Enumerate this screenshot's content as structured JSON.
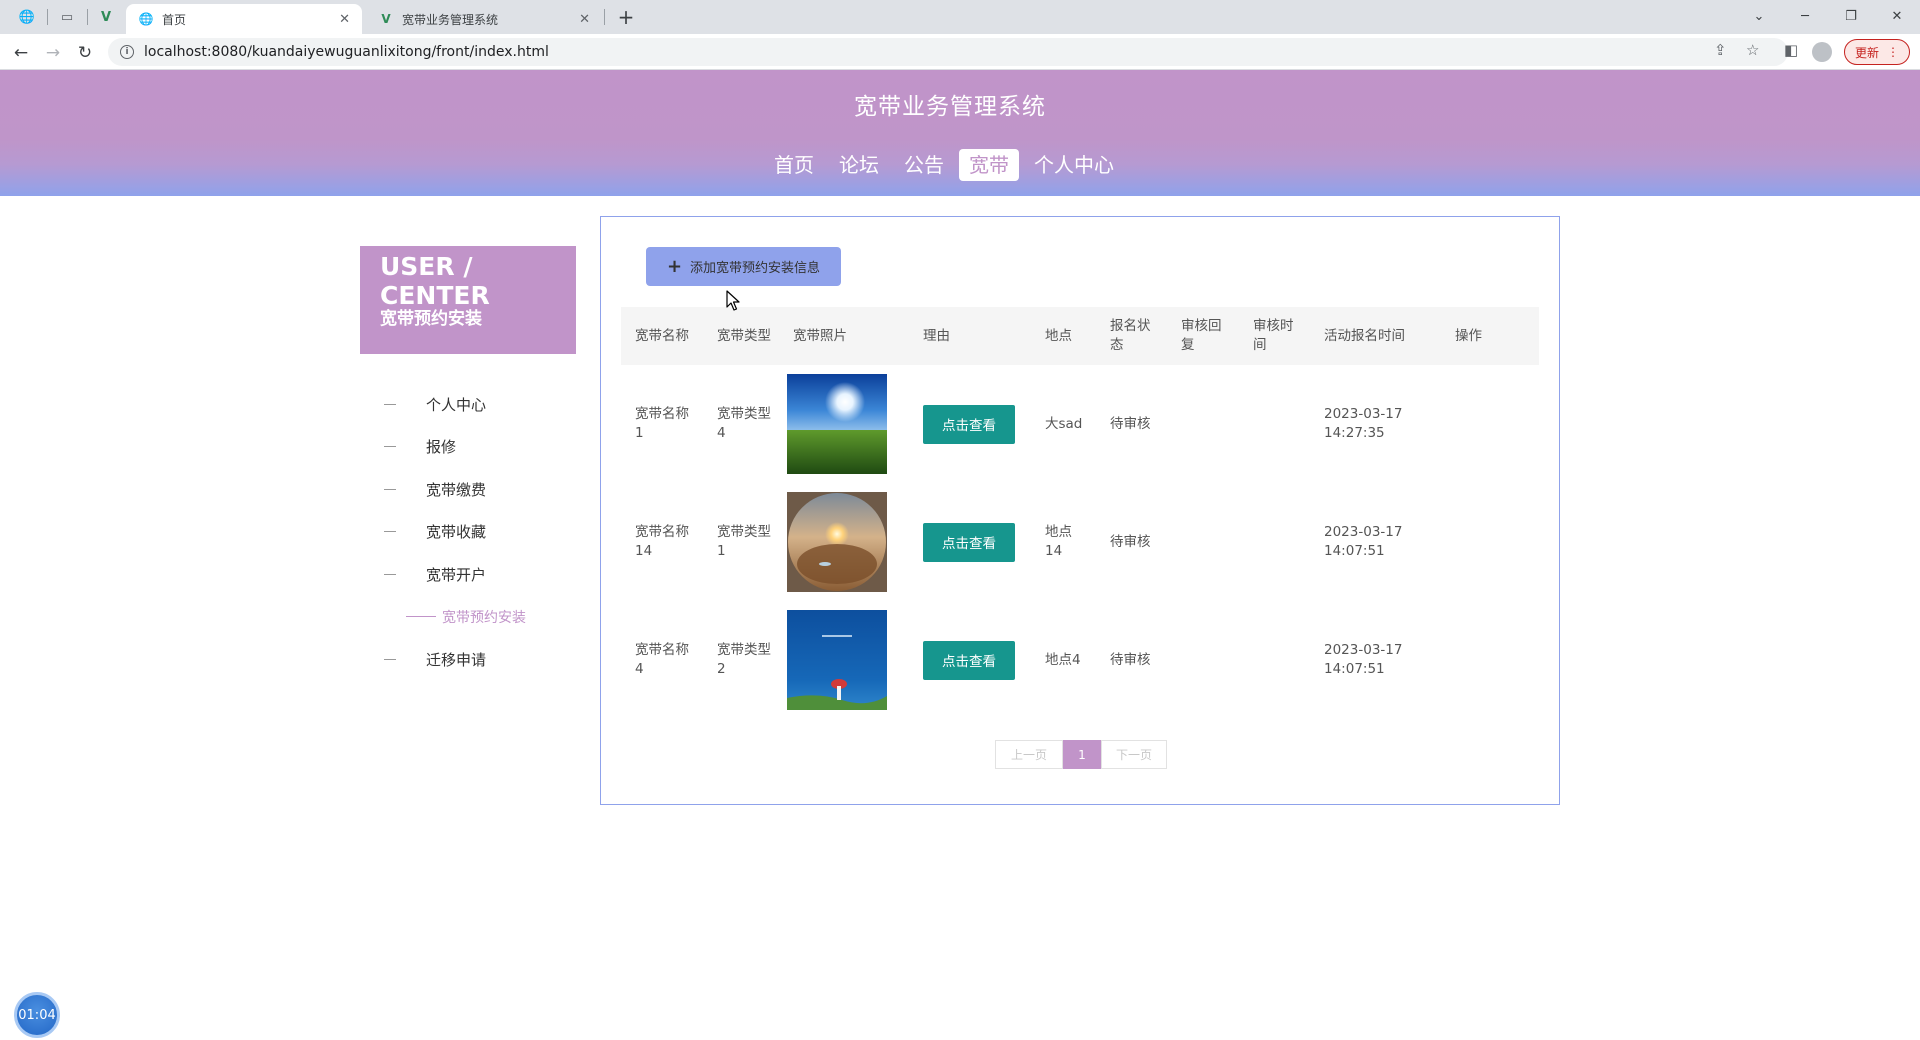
{
  "browser": {
    "tabs": [
      {
        "title": "首页",
        "active": true
      },
      {
        "title": "宽带业务管理系统",
        "active": false
      }
    ],
    "url": "localhost:8080/kuandaiyewuguanlixitong/front/index.html",
    "update_label": "更新"
  },
  "site": {
    "title": "宽带业务管理系统",
    "nav": [
      "首页",
      "论坛",
      "公告",
      "宽带",
      "个人中心"
    ],
    "active_nav": "宽带"
  },
  "sidebar": {
    "title_en": "USER / CENTER",
    "title_cn": "宽带预约安装",
    "items": [
      "个人中心",
      "报修",
      "宽带缴费",
      "宽带收藏",
      "宽带开户",
      "宽带预约安装",
      "迁移申请"
    ],
    "active_item": "宽带预约安装"
  },
  "content": {
    "add_button": "添加宽带预约安装信息",
    "columns": [
      "宽带名称",
      "宽带类型",
      "宽带照片",
      "理由",
      "地点",
      "报名状态",
      "审核回复",
      "审核时间",
      "活动报名时间",
      "操作"
    ],
    "rows": [
      {
        "name": "宽带名称1",
        "type": "宽带类型4",
        "photo_icon": "meadow-sun-photo",
        "reason_button": "点击查看",
        "location": "大sad",
        "status": "待审核",
        "reply": "",
        "review_time": "",
        "signup_time": "2023-03-17 14:27:35",
        "action": ""
      },
      {
        "name": "宽带名称14",
        "type": "宽带类型1",
        "photo_icon": "desert-sunset-photo",
        "reason_button": "点击查看",
        "location": "地点14",
        "status": "待审核",
        "reply": "",
        "review_time": "",
        "signup_time": "2023-03-17 14:07:51",
        "action": ""
      },
      {
        "name": "宽带名称4",
        "type": "宽带类型2",
        "photo_icon": "sea-umbrella-photo",
        "reason_button": "点击查看",
        "location": "地点4",
        "status": "待审核",
        "reply": "",
        "review_time": "",
        "signup_time": "2023-03-17 14:07:51",
        "action": ""
      }
    ],
    "pagination": {
      "prev": "上一页",
      "current": "1",
      "next": "下一页"
    }
  },
  "overlay": {
    "timer": "01:04"
  },
  "colors": {
    "accent": "#c194c9",
    "header_blue": "#8fa2eb",
    "teal_button": "#16968e"
  }
}
